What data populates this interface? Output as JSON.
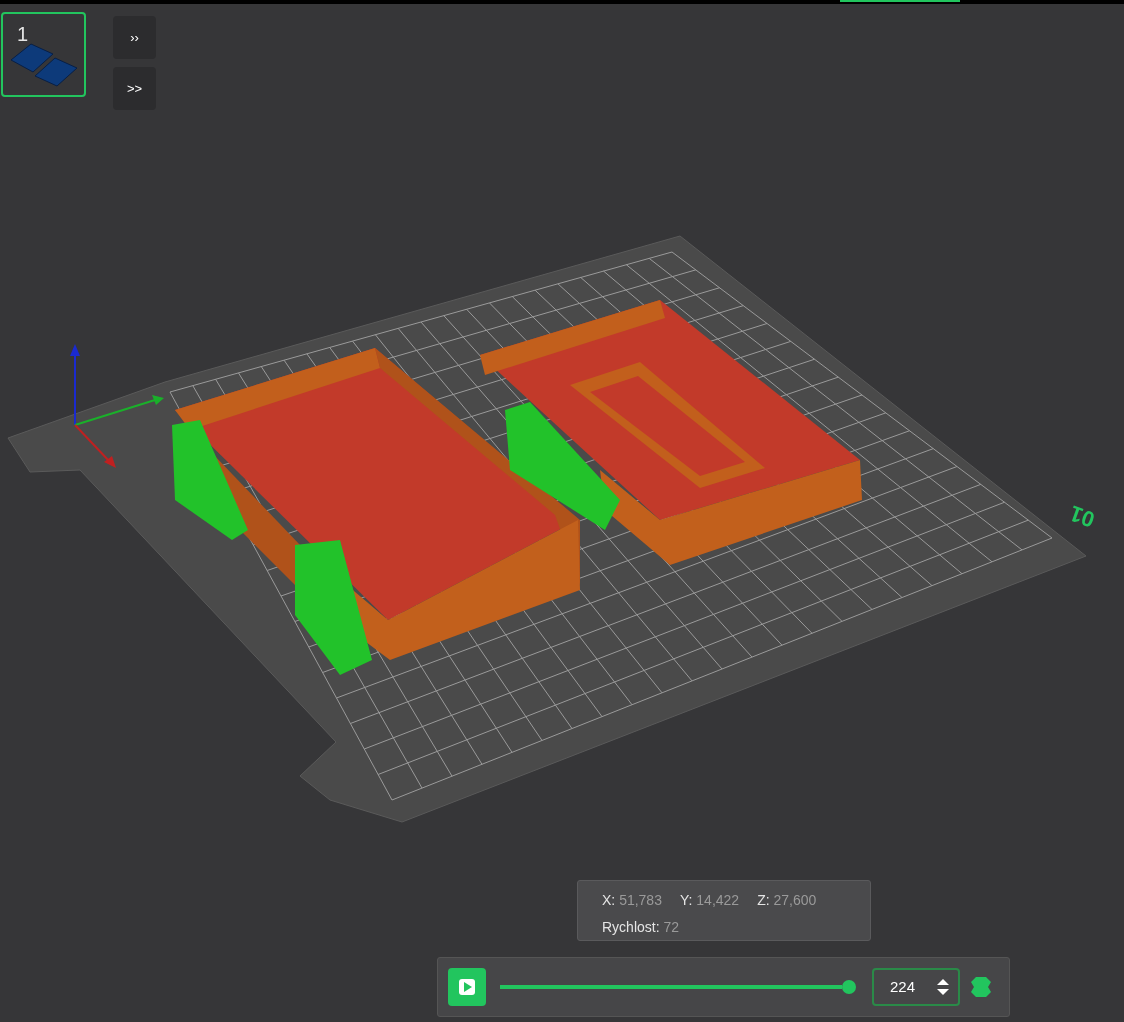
{
  "plate_thumbnail": {
    "label": "1",
    "selected": true
  },
  "side_buttons": [
    {
      "label": "››"
    },
    {
      "label": ">>"
    }
  ],
  "bed_label": "01",
  "info_panel": {
    "coords": [
      {
        "label": "X:",
        "value": "51,783"
      },
      {
        "label": "Y:",
        "value": "14,422"
      },
      {
        "label": "Z:",
        "value": "27,600"
      }
    ],
    "speed": {
      "label": "Rychlost:",
      "value": "72"
    }
  },
  "layer_slider": {
    "level": 1,
    "value": "224"
  }
}
